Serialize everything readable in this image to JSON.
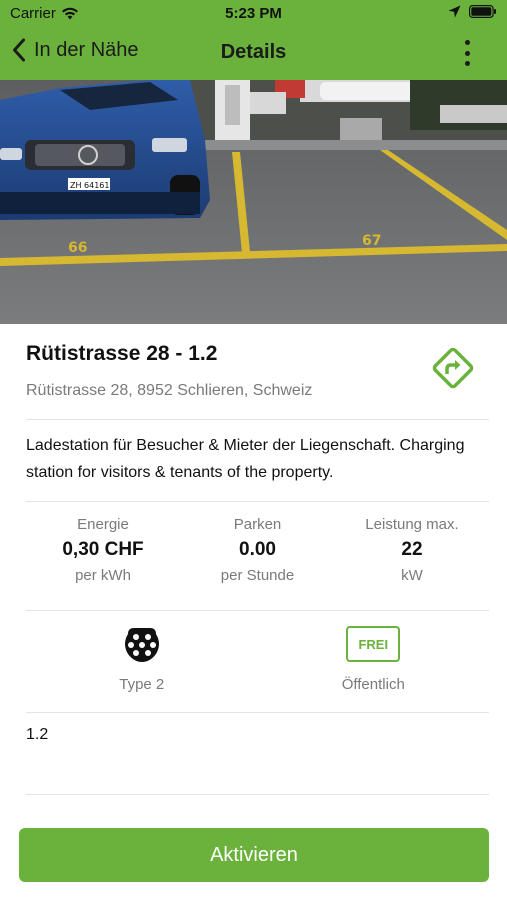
{
  "status_bar": {
    "carrier": "Carrier",
    "time": "5:23 PM"
  },
  "nav": {
    "back_label": "In der Nähe",
    "title": "Details"
  },
  "station": {
    "name": "Rütistrasse 28 - 1.2",
    "address": "Rütistrasse 28, 8952 Schlieren, Schweiz",
    "description": "Ladestation für Besucher & Mieter der Liegenschaft. Charging station for visitors & tenants of the property.",
    "code": "1.2"
  },
  "stats": [
    {
      "label": "Energie",
      "value": "0,30 CHF",
      "unit": "per kWh"
    },
    {
      "label": "Parken",
      "value": "0.00",
      "unit": "per Stunde"
    },
    {
      "label": "Leistung max.",
      "value": "22",
      "unit": "kW"
    }
  ],
  "features": {
    "connector_label": "Type 2",
    "access_badge": "FREI",
    "access_label": "Öffentlich"
  },
  "photo": {
    "parking_numbers": [
      "66",
      "67"
    ],
    "plate": "ZH 64161"
  },
  "actions": {
    "activate_label": "Aktivieren"
  },
  "colors": {
    "brand_green": "#6ab23c",
    "muted_text": "#7a7a7a"
  }
}
